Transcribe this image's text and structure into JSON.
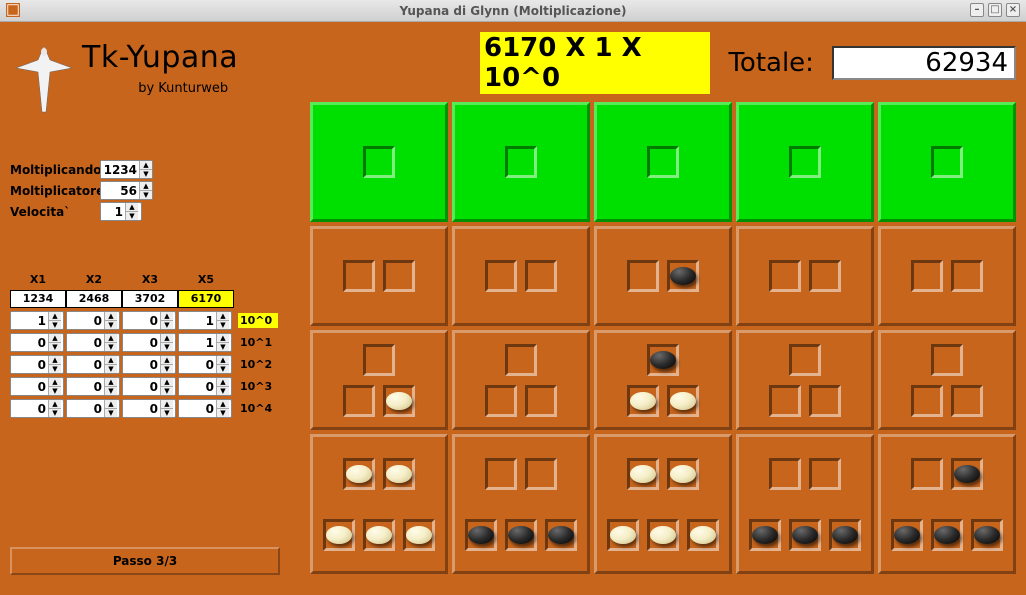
{
  "window": {
    "title": "Yupana di Glynn (Moltiplicazione)"
  },
  "header": {
    "app_name": "Tk-Yupana",
    "byline": "by Kunturweb"
  },
  "inputs": {
    "moltiplicando": {
      "label": "Moltiplicando",
      "value": "1234"
    },
    "moltiplicatore": {
      "label": "Moltiplicatore",
      "value": "56"
    },
    "velocita": {
      "label": "Velocita`",
      "value": "1"
    }
  },
  "xtable": {
    "headers": [
      "X1",
      "X2",
      "X3",
      "X5"
    ],
    "mults": [
      "1234",
      "2468",
      "3702",
      "6170"
    ],
    "mults_highlight_index": 3,
    "rows": [
      {
        "label": "10^0",
        "highlight": true,
        "cells": [
          "1",
          "0",
          "0",
          "1"
        ]
      },
      {
        "label": "10^1",
        "highlight": false,
        "cells": [
          "0",
          "0",
          "0",
          "1"
        ]
      },
      {
        "label": "10^2",
        "highlight": false,
        "cells": [
          "0",
          "0",
          "0",
          "0"
        ]
      },
      {
        "label": "10^3",
        "highlight": false,
        "cells": [
          "0",
          "0",
          "0",
          "0"
        ]
      },
      {
        "label": "10^4",
        "highlight": false,
        "cells": [
          "0",
          "0",
          "0",
          "0"
        ]
      }
    ]
  },
  "passo": {
    "label": "Passo 3/3"
  },
  "expression": "6170 X 1 X 10^0",
  "totale": {
    "label": "Totale:",
    "value": "62934"
  },
  "board": {
    "columns": [
      {
        "cells": [
          {
            "color": "green",
            "rows": [
              [
                0
              ]
            ]
          },
          {
            "color": "orange",
            "rows": [
              [
                0,
                0
              ]
            ]
          },
          {
            "color": "orange",
            "rows": [
              [
                0
              ],
              [
                0,
                "w"
              ]
            ]
          },
          {
            "color": "orange",
            "rows": [
              [
                "w",
                "w"
              ],
              [
                "w",
                "w",
                "w"
              ]
            ]
          }
        ]
      },
      {
        "cells": [
          {
            "color": "green",
            "rows": [
              [
                0
              ]
            ]
          },
          {
            "color": "orange",
            "rows": [
              [
                0,
                0
              ]
            ]
          },
          {
            "color": "orange",
            "rows": [
              [
                0
              ],
              [
                0,
                0
              ]
            ]
          },
          {
            "color": "orange",
            "rows": [
              [
                0,
                0
              ],
              [
                "b",
                "b",
                "b"
              ]
            ]
          }
        ]
      },
      {
        "cells": [
          {
            "color": "green",
            "rows": [
              [
                0
              ]
            ]
          },
          {
            "color": "orange",
            "rows": [
              [
                0,
                "b"
              ]
            ]
          },
          {
            "color": "orange",
            "rows": [
              [
                "b"
              ],
              [
                "w",
                "w"
              ]
            ]
          },
          {
            "color": "orange",
            "rows": [
              [
                "w",
                "w"
              ],
              [
                "w",
                "w",
                "w"
              ]
            ]
          }
        ]
      },
      {
        "cells": [
          {
            "color": "green",
            "rows": [
              [
                0
              ]
            ]
          },
          {
            "color": "orange",
            "rows": [
              [
                0,
                0
              ]
            ]
          },
          {
            "color": "orange",
            "rows": [
              [
                0
              ],
              [
                0,
                0
              ]
            ]
          },
          {
            "color": "orange",
            "rows": [
              [
                0,
                0
              ],
              [
                "b",
                "b",
                "b"
              ]
            ]
          }
        ]
      },
      {
        "cells": [
          {
            "color": "green",
            "rows": [
              [
                0
              ]
            ]
          },
          {
            "color": "orange",
            "rows": [
              [
                0,
                0
              ]
            ]
          },
          {
            "color": "orange",
            "rows": [
              [
                0
              ],
              [
                0,
                0
              ]
            ]
          },
          {
            "color": "orange",
            "rows": [
              [
                0,
                "b"
              ],
              [
                "b",
                "b",
                "b"
              ]
            ]
          }
        ]
      }
    ]
  }
}
